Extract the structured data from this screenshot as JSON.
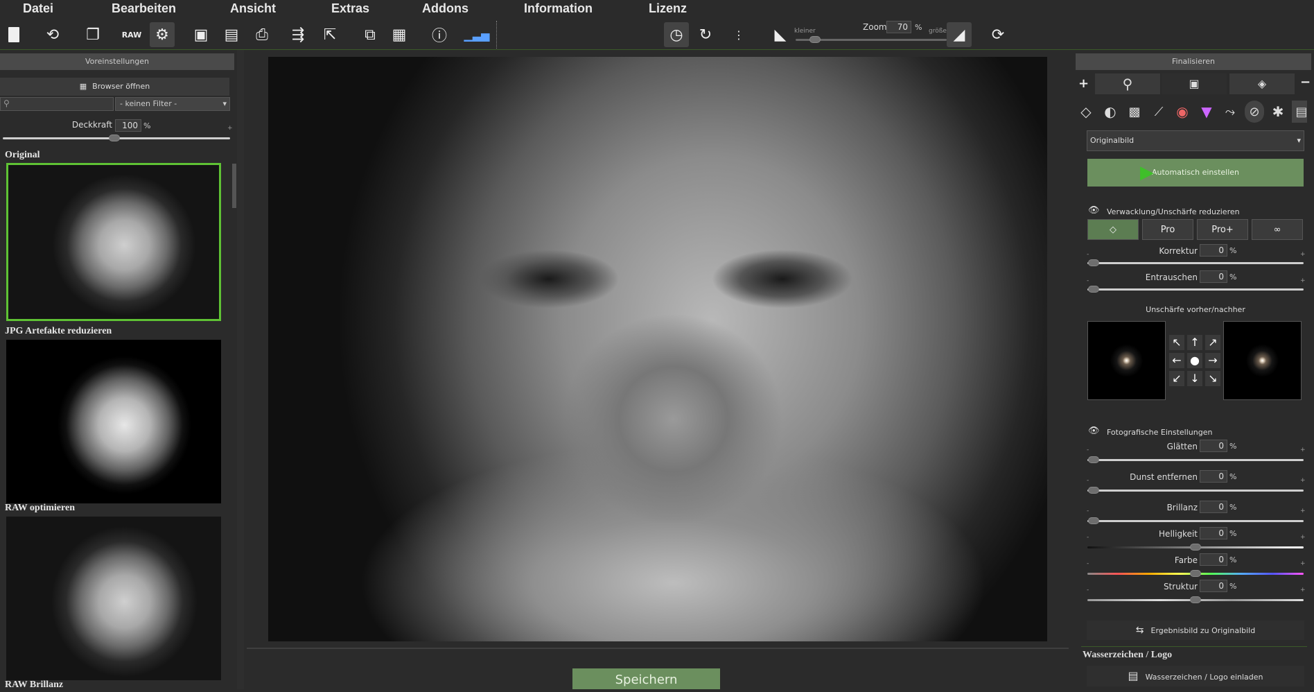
{
  "menu": {
    "items": [
      "Datei",
      "Bearbeiten",
      "Ansicht",
      "Extras",
      "Addons",
      "Information",
      "Lizenz"
    ]
  },
  "toolbar": {
    "zoom_label": "Zoom",
    "zoom_value": "70",
    "zoom_unit": "%",
    "zoom_smaller": "kleiner",
    "zoom_bigger": "größer",
    "zoom_level": 0.1
  },
  "left_panel": {
    "header": "Voreinstellungen",
    "browser_button": "Browser öffnen",
    "filter_select": "- keinen Filter -",
    "opacity_label": "Deckkraft",
    "opacity_value": "100",
    "opacity_unit": "%",
    "plus": "+",
    "presets": [
      "Original",
      "JPG Artefakte reduzieren",
      "RAW optimieren",
      "RAW Brillanz"
    ]
  },
  "right_panel": {
    "header": "Finalisieren",
    "plus": "+",
    "minus": "−",
    "source_select": "Originalbild",
    "auto_button": "Automatisch einstellen",
    "blur_section": {
      "title": "Verwacklung/Unschärfe reduzieren",
      "modes": [
        "",
        "Pro",
        "Pro+",
        ""
      ],
      "sliders": [
        {
          "label": "Korrektur",
          "value": "0",
          "unit": "%"
        },
        {
          "label": "Entrauschen",
          "value": "0",
          "unit": "%"
        }
      ],
      "preview_title": "Unschärfe vorher/nachher"
    },
    "photo_section": {
      "title": "Fotografische Einstellungen",
      "sliders": [
        {
          "label": "Glätten",
          "value": "0",
          "unit": "%"
        },
        {
          "label": "Dunst entfernen",
          "value": "0",
          "unit": "%"
        },
        {
          "label": "Brillanz",
          "value": "0",
          "unit": "%"
        },
        {
          "label": "Helligkeit",
          "value": "0",
          "unit": "%"
        },
        {
          "label": "Farbe",
          "value": "0",
          "unit": "%"
        },
        {
          "label": "Struktur",
          "value": "0",
          "unit": "%"
        }
      ]
    },
    "result_button": "Ergebnisbild zu Originalbild",
    "watermark_title": "Wasserzeichen / Logo",
    "watermark_button": "Wasserzeichen / Logo einladen",
    "minus_sign": "-",
    "plus_sign": "+"
  },
  "main": {
    "save_button": "Speichern"
  },
  "colors": {
    "accent": "#5fc234",
    "button_green": "#6b8f5e",
    "panel": "#2b2b2b"
  }
}
